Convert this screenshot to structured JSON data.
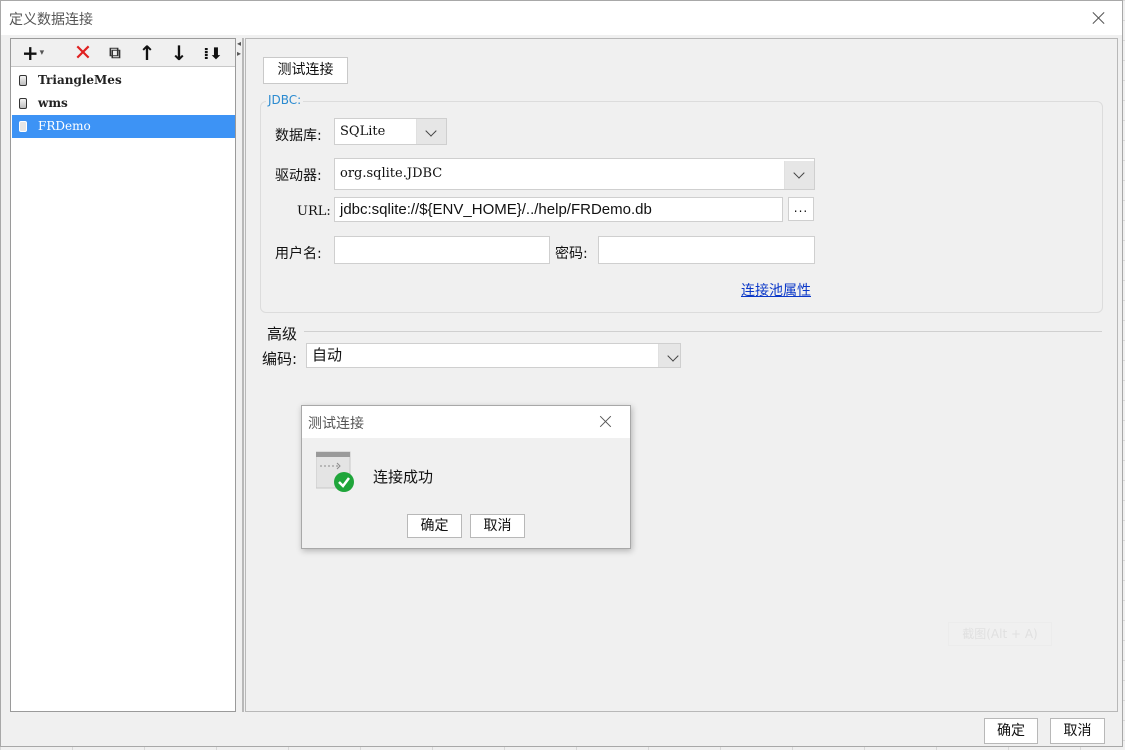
{
  "window": {
    "title": "定义数据连接"
  },
  "toolbar": {
    "add_glyph": "+",
    "add_dropdown_glyph": "▾",
    "delete_glyph": "✕",
    "copy_glyph": "⧉",
    "up_glyph": "↑",
    "down_glyph": "↓",
    "sort_glyph": "⁞⬇"
  },
  "connections": [
    {
      "label": "TriangleMes",
      "selected": false
    },
    {
      "label": "wms",
      "selected": false
    },
    {
      "label": "FRDemo",
      "selected": true
    }
  ],
  "right": {
    "test_button": "测试连接",
    "jdbc_legend": "JDBC:",
    "database_label": "数据库:",
    "database_value": "SQLite",
    "driver_label": "驱动器:",
    "driver_value": "org.sqlite.JDBC",
    "url_label": "URL:",
    "url_value": "jdbc:sqlite://${ENV_HOME}/../help/FRDemo.db",
    "url_browse": "...",
    "username_label": "用户名:",
    "username_value": "",
    "password_label": "密码:",
    "password_value": "",
    "pool_link": "连接池属性",
    "advanced_label": "高级",
    "encoding_label": "编码:",
    "encoding_value": "自动"
  },
  "dialog": {
    "title": "测试连接",
    "message": "连接成功",
    "ok": "确定",
    "cancel": "取消"
  },
  "footer": {
    "ok": "确定",
    "cancel": "取消"
  },
  "watermark": "截图(Alt + A)",
  "colors": {
    "selection": "#3d93f5",
    "link": "#0b38c8",
    "legend": "#2a8ad0",
    "success": "#1fa53a",
    "delete": "#e02020"
  }
}
